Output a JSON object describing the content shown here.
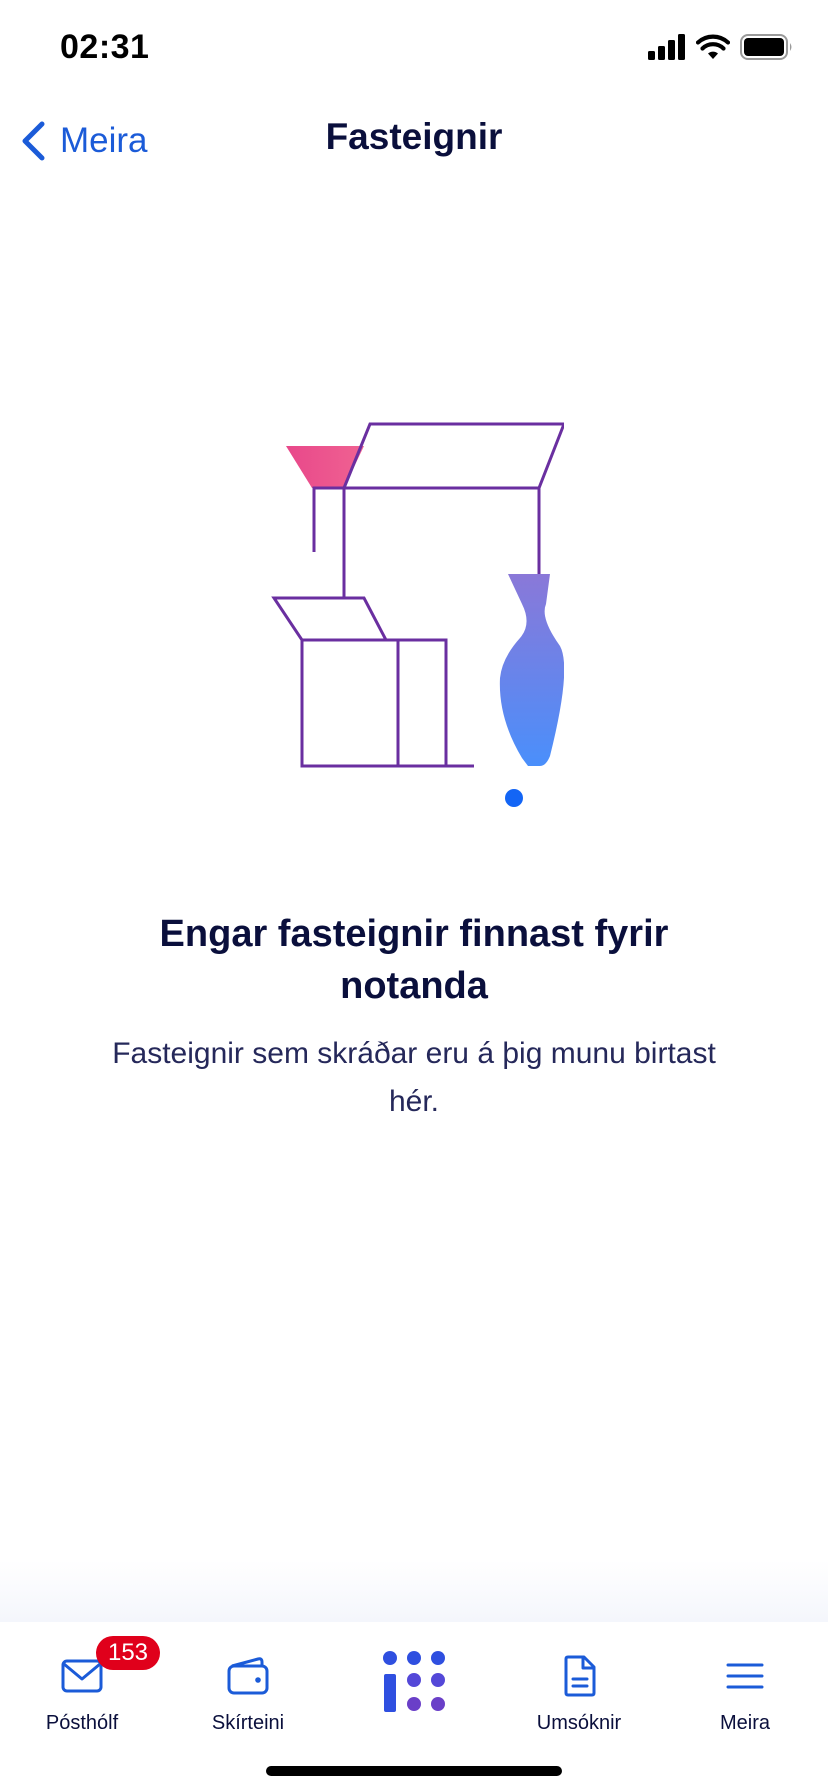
{
  "status_bar": {
    "time": "02:31",
    "icons": [
      "cellular-signal-icon",
      "wifi-icon",
      "battery-icon"
    ]
  },
  "nav": {
    "back_label": "Meira",
    "title": "Fasteignir"
  },
  "empty_state": {
    "title": "Engar fasteignir finnast fyrir notanda",
    "description": "Fasteignir sem skráðar eru á þig munu birtast hér.",
    "illustration": "empty-properties-illustration"
  },
  "tab_bar": {
    "items": [
      {
        "label": "Pósthólf",
        "icon": "mail-icon",
        "badge": "153"
      },
      {
        "label": "Skírteini",
        "icon": "wallet-icon"
      },
      {
        "label": "",
        "icon": "home-logo-icon"
      },
      {
        "label": "Umsóknir",
        "icon": "document-icon"
      },
      {
        "label": "Meira",
        "icon": "menu-icon"
      }
    ]
  },
  "colors": {
    "accent": "#1b5bd8",
    "title": "#0a0f3c",
    "badge": "#e0001b",
    "illustration_stroke": "#6a2fa0",
    "illustration_pink": "#e8488a",
    "illustration_blue": "#4e8ef7"
  }
}
